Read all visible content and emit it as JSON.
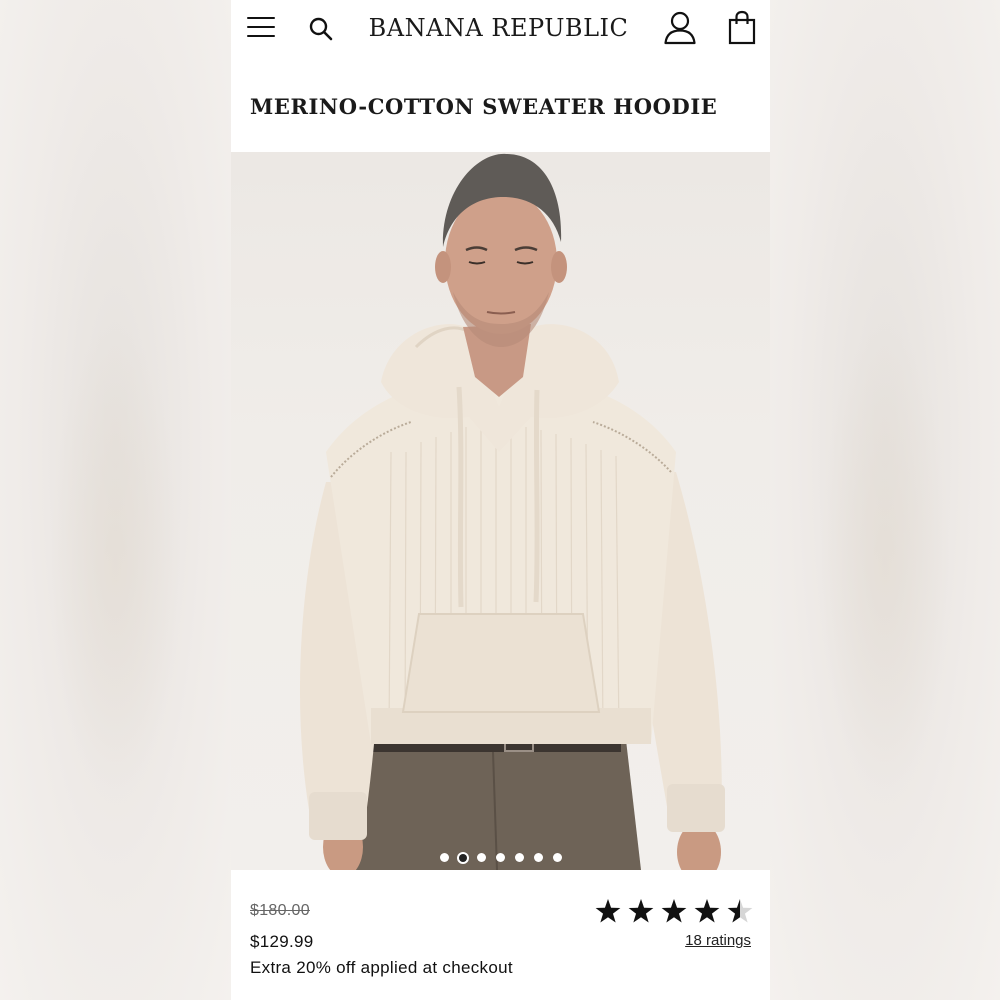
{
  "header": {
    "brand": "BANANA REPUBLIC",
    "menu_icon": "hamburger-menu-icon",
    "search_icon": "search-icon",
    "account_icon": "user-account-icon",
    "bag_icon": "shopping-bag-icon"
  },
  "product": {
    "title": "MERINO-COTTON SWEATER HOODIE",
    "image_carousel": {
      "total_images": 7,
      "active_index": 1
    },
    "original_price": "$180.00",
    "sale_price": "$129.99",
    "promo": "Extra 20% off applied at checkout",
    "rating": {
      "stars": 4.5,
      "max": 5,
      "count_label": "18 ratings"
    }
  },
  "colors": {
    "text": "#111111",
    "muted": "#666666",
    "background": "#ffffff",
    "sweater": "#efe6da",
    "pants": "#6e6357"
  }
}
